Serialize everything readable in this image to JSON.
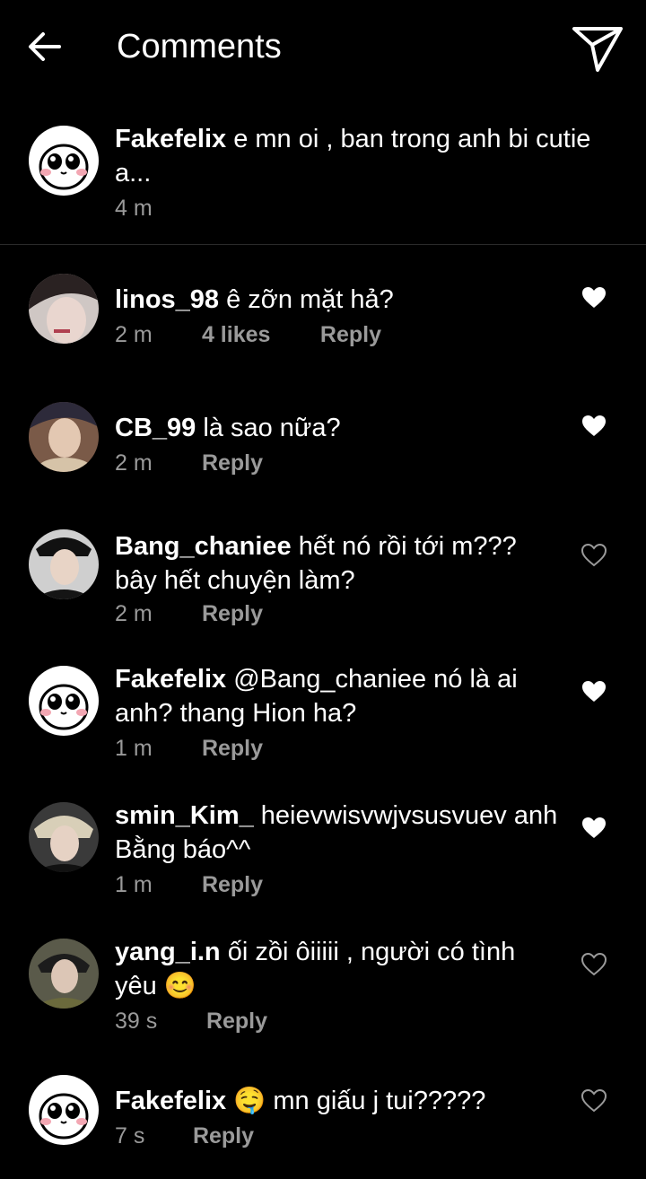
{
  "header": {
    "title": "Comments",
    "back_icon": "arrow-left-icon",
    "share_icon": "paper-plane-icon"
  },
  "caption": {
    "username": "Fakefelix",
    "text": "e mn oi , ban trong anh bi cutie a...",
    "time": "4 m"
  },
  "comments": [
    {
      "username": "linos_98",
      "text": "ê zỡn mặt hả?",
      "time": "2 m",
      "likes": "4 likes",
      "reply": "Reply",
      "liked": true
    },
    {
      "username": "CB_99",
      "text": "là sao nữa?",
      "time": "2 m",
      "likes": "",
      "reply": "Reply",
      "liked": true
    },
    {
      "username": "Bang_chaniee",
      "text": "hết nó rồi tới m??? bây hết chuyện làm?",
      "time": "2 m",
      "likes": "",
      "reply": "Reply",
      "liked": false
    },
    {
      "username": "Fakefelix",
      "text": "@Bang_chaniee nó là ai anh? thang Hion ha?",
      "time": "1 m",
      "likes": "",
      "reply": "Reply",
      "liked": true
    },
    {
      "username": "smin_Kim_",
      "text": "heievwisvwjvsusvuev anh Bằng báo^^",
      "time": "1 m",
      "likes": "",
      "reply": "Reply",
      "liked": true
    },
    {
      "username": "yang_i.n",
      "text": "ối zồi ôiiiii , người có tình yêu 😊",
      "time": "39 s",
      "likes": "",
      "reply": "Reply",
      "liked": false
    },
    {
      "username": "Fakefelix",
      "text": "🤤 mn giấu j tui?????",
      "time": "7 s",
      "likes": "",
      "reply": "Reply",
      "liked": false
    }
  ],
  "colors": {
    "background": "#000000",
    "text": "#ffffff",
    "meta": "#9a9a9a",
    "divider": "#2a2a2a"
  }
}
